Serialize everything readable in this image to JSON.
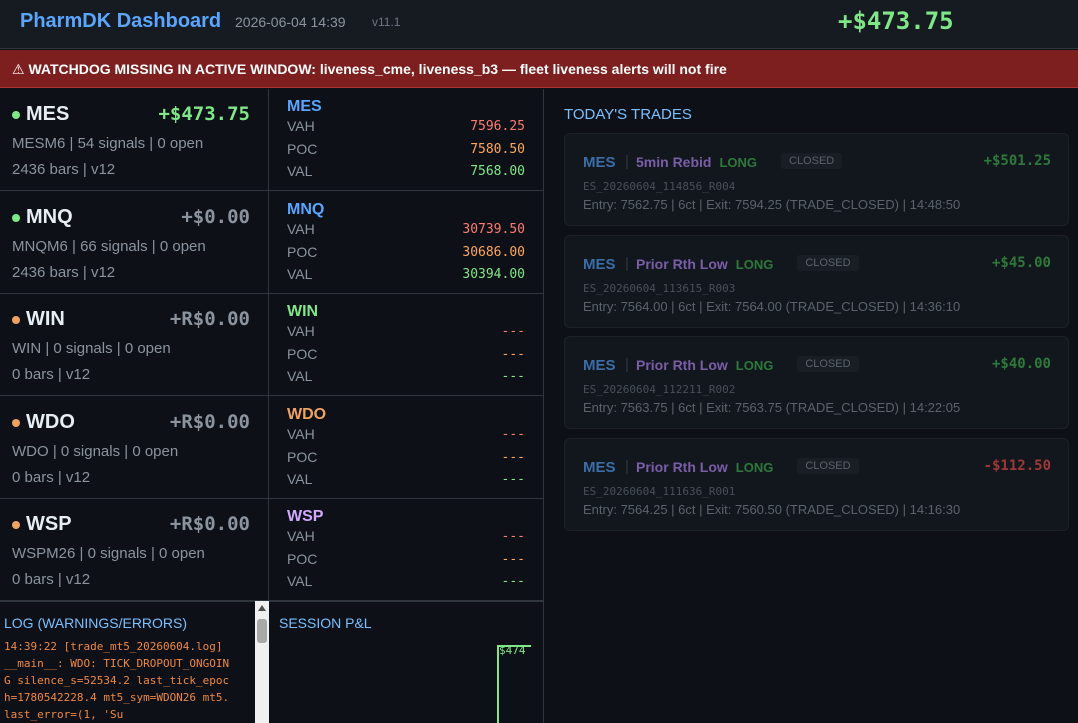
{
  "header": {
    "title": "PharmDK Dashboard",
    "timestamp": "2026-06-04 14:39",
    "version": "v11.1",
    "total_pnl": "+$473.75"
  },
  "banner": {
    "text": "⚠ WATCHDOG MISSING IN ACTIVE WINDOW: liveness_cme, liveness_b3 — fleet liveness alerts will not fire"
  },
  "symbols": [
    {
      "name": "MES",
      "pnl": "+$473.75",
      "line1": "MESM6 | 54 signals | 0 open",
      "line2": "2436 bars | v12",
      "dot_color": "#7ee787",
      "pnl_color": "#7ee787"
    },
    {
      "name": "MNQ",
      "pnl": "+$0.00",
      "line1": "MNQM6 | 66 signals | 0 open",
      "line2": "2436 bars | v12",
      "dot_color": "#7ee787",
      "pnl_color": "#8b949e"
    },
    {
      "name": "WIN",
      "pnl": "+R$0.00",
      "line1": "WIN | 0 signals | 0 open",
      "line2": "0 bars | v12",
      "dot_color": "#f0a35e",
      "pnl_color": "#8b949e"
    },
    {
      "name": "WDO",
      "pnl": "+R$0.00",
      "line1": "WDO | 0 signals | 0 open",
      "line2": "0 bars | v12",
      "dot_color": "#f0a35e",
      "pnl_color": "#8b949e"
    },
    {
      "name": "WSP",
      "pnl": "+R$0.00",
      "line1": "WSPM26 | 0 signals | 0 open",
      "line2": "0 bars | v12",
      "dot_color": "#f0a35e",
      "pnl_color": "#8b949e"
    }
  ],
  "levels": [
    {
      "symbol": "MES",
      "color": "#58a6ff",
      "vah_label": "VAH",
      "vah": "7596.25",
      "poc_label": "POC",
      "poc": "7580.50",
      "val_label": "VAL",
      "val": "7568.00"
    },
    {
      "symbol": "MNQ",
      "color": "#58a6ff",
      "vah_label": "VAH",
      "vah": "30739.50",
      "poc_label": "POC",
      "poc": "30686.00",
      "val_label": "VAL",
      "val": "30394.00"
    },
    {
      "symbol": "WIN",
      "color": "#7ee787",
      "vah_label": "VAH",
      "vah": "---",
      "poc_label": "POC",
      "poc": "---",
      "val_label": "VAL",
      "val": "---"
    },
    {
      "symbol": "WDO",
      "color": "#f0a35e",
      "vah_label": "VAH",
      "vah": "---",
      "poc_label": "POC",
      "poc": "---",
      "val_label": "VAL",
      "val": "---"
    },
    {
      "symbol": "WSP",
      "color": "#d2a8ff",
      "vah_label": "VAH",
      "vah": "---",
      "poc_label": "POC",
      "poc": "---",
      "val_label": "VAL",
      "val": "---"
    }
  ],
  "level_colors": {
    "vah": "#ff7b72",
    "poc": "#ffa657",
    "val": "#7ee787"
  },
  "log": {
    "title": "LOG (WARNINGS/ERRORS)",
    "text": "14:39:22 [trade_mt5_20260604.log]\n__main__: WDO: TICK_DROPOUT_ONGOIN\nG silence_s=52534.2 last_tick_epoc\nh=1780542228.4 mt5_sym=WDON26 mt5.\nlast_error=(1, 'Su"
  },
  "session": {
    "title": "SESSION P&L",
    "end_label": "$474"
  },
  "trades": {
    "title": "TODAY'S TRADES",
    "items": [
      {
        "symbol": "MES",
        "strategy": "5min Rebid",
        "side": "LONG",
        "status": "CLOSED",
        "pnl": "+$501.25",
        "pnl_color": "#3fb950",
        "id": "ES_20260604_114856_R004",
        "detail": "Entry: 7562.75 | 6ct | Exit: 7594.25 (TRADE_CLOSED) | 14:48:50"
      },
      {
        "symbol": "MES",
        "strategy": "Prior Rth Low",
        "side": "LONG",
        "status": "CLOSED",
        "pnl": "+$45.00",
        "pnl_color": "#3fb950",
        "id": "ES_20260604_113615_R003",
        "detail": "Entry: 7564.00 | 6ct | Exit: 7564.00 (TRADE_CLOSED) | 14:36:10"
      },
      {
        "symbol": "MES",
        "strategy": "Prior Rth Low",
        "side": "LONG",
        "status": "CLOSED",
        "pnl": "+$40.00",
        "pnl_color": "#3fb950",
        "id": "ES_20260604_112211_R002",
        "detail": "Entry: 7563.75 | 6ct | Exit: 7563.75 (TRADE_CLOSED) | 14:22:05"
      },
      {
        "symbol": "MES",
        "strategy": "Prior Rth Low",
        "side": "LONG",
        "status": "CLOSED",
        "pnl": "-$112.50",
        "pnl_color": "#f85149",
        "id": "ES_20260604_111636_R001",
        "detail": "Entry: 7564.25 | 6ct | Exit: 7560.50 (TRADE_CLOSED) | 14:16:30"
      }
    ]
  }
}
